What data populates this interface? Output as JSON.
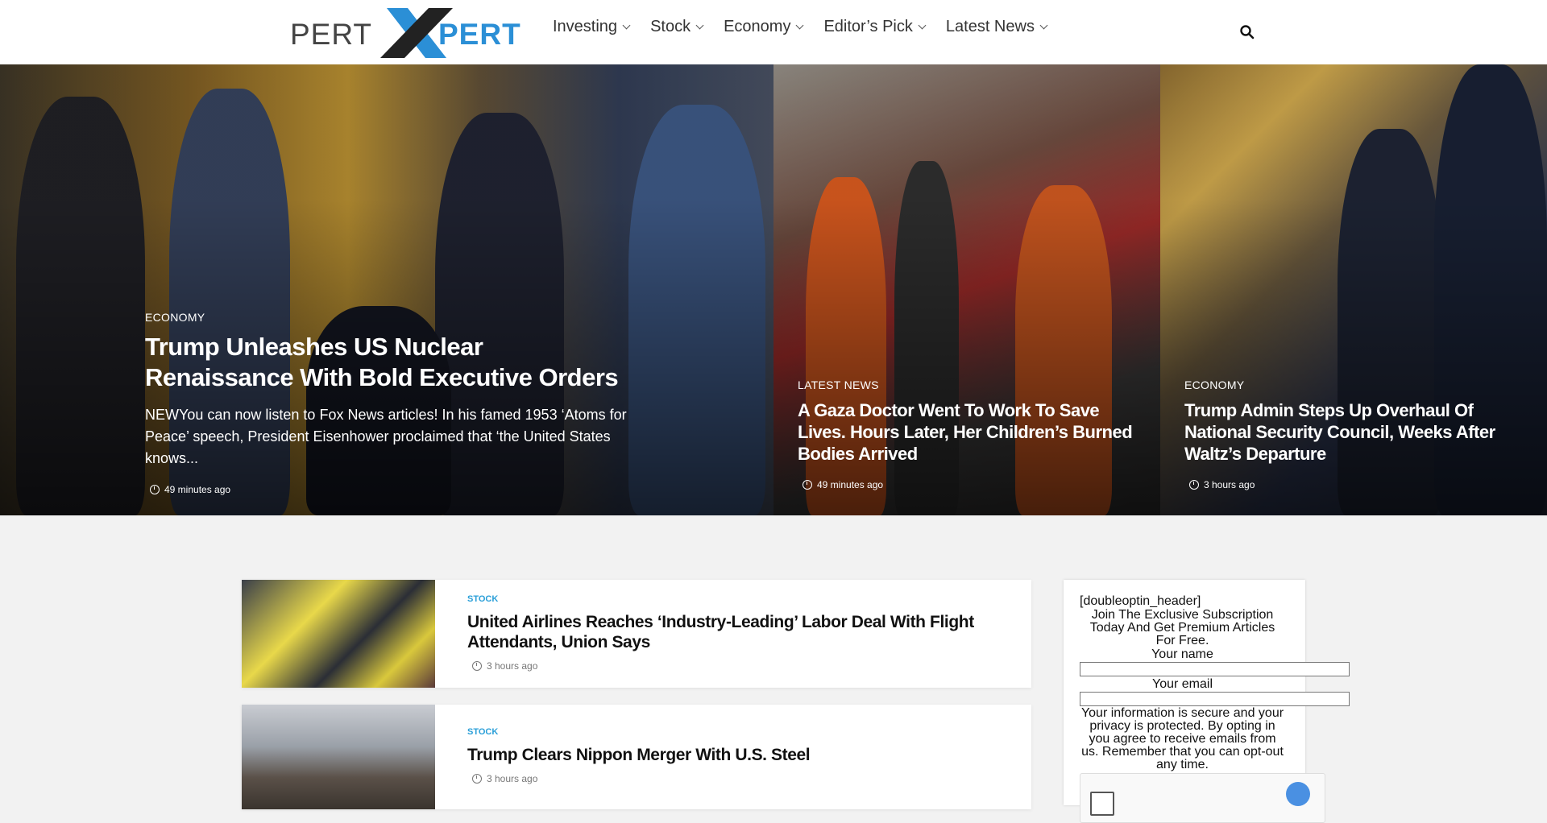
{
  "header": {
    "logo": {
      "left": "PERT",
      "right": "PERT"
    },
    "nav": [
      {
        "label": "Investing"
      },
      {
        "label": "Stock"
      },
      {
        "label": "Economy"
      },
      {
        "label": "Editor’s Pick"
      },
      {
        "label": "Latest News"
      }
    ],
    "search_icon": "search-icon"
  },
  "hero": {
    "main": {
      "category": "ECONOMY",
      "title": "Trump Unleashes US Nuclear Renaissance With Bold Executive Orders",
      "excerpt": "NEWYou can now listen to Fox News articles! In his famed 1953 ‘Atoms for Peace’ speech, President Eisenhower proclaimed that ‘the United States knows...",
      "time": "49 minutes ago"
    },
    "second": {
      "category": "LATEST NEWS",
      "title": "A Gaza Doctor Went To Work To Save Lives. Hours Later, Her Children’s Burned Bodies Arrived",
      "time": "49 minutes ago"
    },
    "third": {
      "category": "ECONOMY",
      "title": "Trump Admin Steps Up Overhaul Of National Security Council, Weeks After Waltz’s Departure",
      "time": "3 hours ago"
    }
  },
  "list": [
    {
      "category": "STOCK",
      "title": "United Airlines Reaches ‘Industry-Leading’ Labor Deal With Flight Attendants, Union Says",
      "time": "3 hours ago"
    },
    {
      "category": "STOCK",
      "title": "Trump Clears Nippon Merger With U.S. Steel",
      "time": "3 hours ago"
    }
  ],
  "sidebar": {
    "header": "[doubleoptin_header]",
    "intro": "Join The Exclusive Subscription Today And Get Premium Articles For Free.",
    "name_label": "Your name",
    "email_label": "Your email",
    "privacy": "Your information is secure and your privacy is protected. By opting in you agree to receive emails from us. Remember that you can opt-out any time."
  },
  "colors": {
    "accent": "#2a9fd8",
    "logo_blue": "#2b8fd6"
  }
}
